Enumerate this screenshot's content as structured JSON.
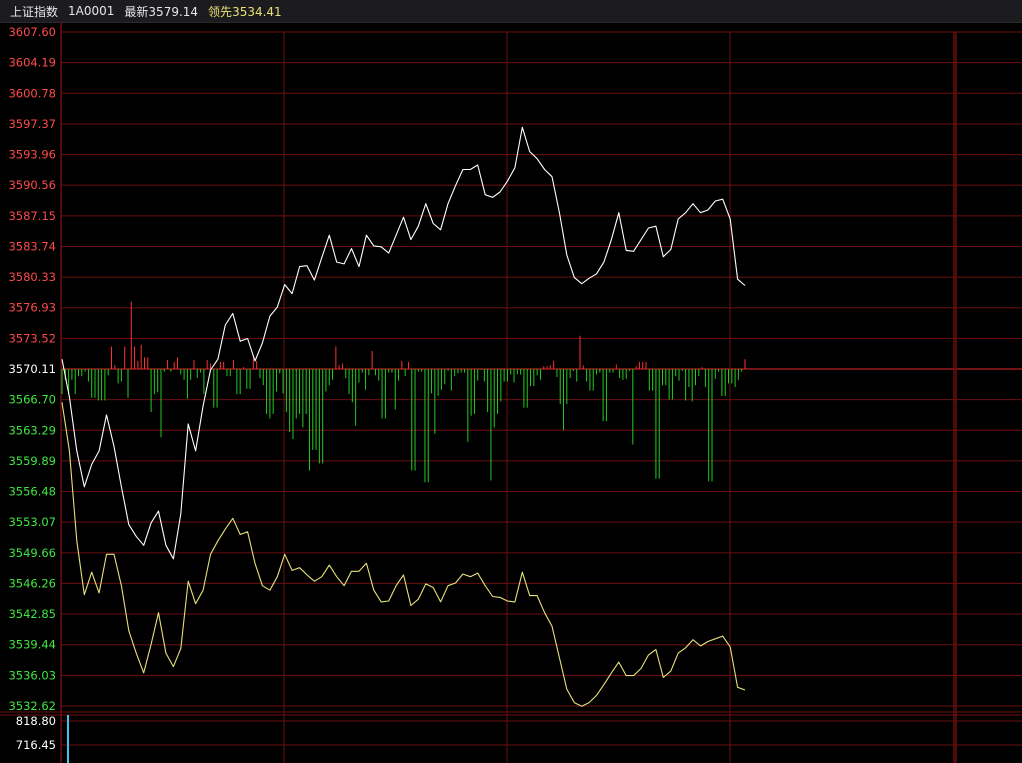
{
  "header": {
    "index_name": "上证指数",
    "code": "1A0001",
    "latest_label": "最新",
    "latest_value": "3579.14",
    "lead_label": "领先",
    "lead_value": "3534.41"
  },
  "colors": {
    "grid": "#6e0f0f",
    "up_label": "#ff4a4a",
    "down_label": "#3ee83e",
    "base_label": "#ffffff",
    "price_line": "#ffffff",
    "lead_line": "#e8e07a",
    "bar_up": "#ff3030",
    "bar_down": "#22cc22",
    "vol_bar": "#3fc8e6"
  },
  "chart_data": {
    "type": "line",
    "base_price": 3570.11,
    "price_ticks": [
      "3607.60",
      "3604.19",
      "3600.78",
      "3597.37",
      "3593.96",
      "3590.56",
      "3587.15",
      "3583.74",
      "3580.33",
      "3576.93",
      "3573.52",
      "3570.11",
      "3566.70",
      "3563.29",
      "3559.89",
      "3556.48",
      "3553.07",
      "3549.66",
      "3546.26",
      "3542.85",
      "3539.44",
      "3536.03",
      "3532.62"
    ],
    "ylim": [
      3532.62,
      3607.6
    ],
    "series": [
      {
        "role": "price",
        "values": [
          3571.2,
          3567.0,
          3561.0,
          3557.0,
          3559.5,
          3561.0,
          3565.0,
          3561.5,
          3557.0,
          3552.8,
          3551.5,
          3550.5,
          3553.0,
          3554.3,
          3550.5,
          3549.0,
          3554.0,
          3564.0,
          3561.0,
          3566.0,
          3570.0,
          3571.2,
          3575.0,
          3576.3,
          3573.2,
          3573.5,
          3571.0,
          3573.0,
          3576.0,
          3577.0,
          3579.5,
          3578.5,
          3581.5,
          3581.6,
          3580.0,
          3582.5,
          3585.0,
          3582.0,
          3581.8,
          3583.5,
          3581.5,
          3585.0,
          3583.8,
          3583.7,
          3583.0,
          3585.0,
          3587.0,
          3584.5,
          3586.0,
          3588.5,
          3586.3,
          3585.6,
          3588.5,
          3590.5,
          3592.3,
          3592.3,
          3592.8,
          3589.5,
          3589.2,
          3589.8,
          3591.0,
          3592.5,
          3597.0,
          3594.3,
          3593.5,
          3592.3,
          3591.5,
          3587.5,
          3582.8,
          3580.3,
          3579.6,
          3580.2,
          3580.7,
          3582.0,
          3584.5,
          3587.5,
          3583.3,
          3583.2,
          3584.5,
          3585.8,
          3586.0,
          3582.6,
          3583.4,
          3586.8,
          3587.5,
          3588.5,
          3587.5,
          3587.8,
          3588.8,
          3589.0,
          3586.8,
          3580.1,
          3579.4
        ]
      },
      {
        "role": "lead",
        "values": [
          3566.4,
          3561.0,
          3551.0,
          3545.0,
          3547.5,
          3545.2,
          3549.5,
          3549.5,
          3546.0,
          3541.0,
          3538.5,
          3536.3,
          3539.5,
          3543.0,
          3538.5,
          3537.0,
          3539.0,
          3546.5,
          3544.0,
          3545.5,
          3549.5,
          3551.0,
          3552.3,
          3553.5,
          3551.7,
          3552.0,
          3548.5,
          3546.0,
          3545.5,
          3547.0,
          3549.5,
          3547.7,
          3548.0,
          3547.2,
          3546.5,
          3547.0,
          3548.3,
          3547.0,
          3546.0,
          3547.6,
          3547.6,
          3548.5,
          3545.5,
          3544.2,
          3544.3,
          3546.0,
          3547.2,
          3543.8,
          3544.5,
          3546.2,
          3545.8,
          3544.2,
          3546.0,
          3546.3,
          3547.3,
          3547.0,
          3547.4,
          3546.0,
          3544.8,
          3544.7,
          3544.3,
          3544.2,
          3547.5,
          3544.9,
          3544.9,
          3543.0,
          3541.5,
          3538.0,
          3534.5,
          3533.0,
          3532.6,
          3533.0,
          3533.8,
          3535.0,
          3536.3,
          3537.5,
          3536.0,
          3536.0,
          3536.8,
          3538.3,
          3538.9,
          3535.8,
          3536.5,
          3538.5,
          3539.1,
          3540.0,
          3539.3,
          3539.8,
          3540.1,
          3540.4,
          3539.2,
          3534.7,
          3534.4
        ]
      }
    ],
    "bars": [
      -2.8,
      -1.2,
      -2.8,
      -1.2,
      -2.8,
      -0.8,
      -0.8,
      -0.3,
      -1.4,
      -3.2,
      -3.2,
      -3.5,
      -3.5,
      -3.5,
      -0.7,
      2.5,
      0.4,
      -1.6,
      -1.4,
      2.5,
      -3.2,
      7.5,
      2.5,
      0.9,
      2.7,
      1.3,
      1.3,
      -4.8,
      -2.8,
      -2.6,
      -7.6,
      -0.3,
      1.0,
      -0.3,
      0.8,
      1.3,
      -0.6,
      -1.2,
      -3.3,
      -1.2,
      1.0,
      -1.0,
      -0.4,
      -2.8,
      1.0,
      0.6,
      -4.3,
      -4.3,
      0.8,
      0.8,
      -0.8,
      -0.8,
      1.0,
      -2.8,
      -2.8,
      0.2,
      -2.2,
      -2.2,
      1.5,
      0.9,
      -1.0,
      -1.8,
      -5.0,
      -5.5,
      -5.0,
      -2.5,
      -0.5,
      -2.7,
      -4.8,
      -7.0,
      -7.8,
      -5.5,
      -5.0,
      -6.5,
      -5.0,
      -11.3,
      -9.0,
      -9.0,
      -10.5,
      -10.5,
      -2.5,
      -1.8,
      -1.2,
      2.5,
      0.4,
      0.6,
      -1.0,
      -2.8,
      -3.7,
      -6.3,
      -1.5,
      -0.4,
      -2.3,
      -0.7,
      2.0,
      -0.7,
      -1.3,
      -5.5,
      -5.5,
      -0.4,
      -0.4,
      -4.5,
      -1.3,
      0.9,
      -0.8,
      0.8,
      -11.3,
      -11.3,
      -0.3,
      -0.3,
      -12.6,
      -12.6,
      -2.7,
      -7.2,
      -3.0,
      -2.3,
      -1.7,
      -0.2,
      -2.4,
      -0.8,
      -0.5,
      -0.4,
      -0.4,
      -8.1,
      -5.2,
      -5.0,
      -1.3,
      -0.1,
      -1.4,
      -4.8,
      -12.4,
      -6.5,
      -5.0,
      -3.6,
      -1.4,
      -1.4,
      -0.6,
      -1.5,
      -0.6,
      -0.6,
      -4.3,
      -4.3,
      -1.9,
      -1.9,
      -0.7,
      -1.2,
      0.3,
      0.3,
      0.4,
      0.9,
      -0.9,
      -3.9,
      -6.8,
      -3.9,
      -1.0,
      -0.2,
      -1.4,
      3.7,
      0.4,
      -1.4,
      -2.4,
      -2.4,
      -0.6,
      -0.4,
      -5.8,
      -5.8,
      -0.4,
      -0.4,
      0.5,
      -1.0,
      -1.2,
      -1.1,
      -0.2,
      -8.4,
      0.3,
      0.8,
      0.8,
      0.8,
      -2.4,
      -2.4,
      -12.2,
      -12.2,
      -1.8,
      -1.8,
      -3.4,
      -3.4,
      -0.8,
      -1.3,
      -0.2,
      -3.5,
      -2.0,
      -3.6,
      -1.8,
      -0.8,
      0.2,
      -2.0,
      -12.5,
      -12.5,
      -1.1,
      -0.3,
      -3.0,
      -3.0,
      -1.6,
      -1.6,
      -2.0,
      -1.2,
      -0.3,
      1.1
    ],
    "volume_ticks": [
      "818.80",
      "716.45"
    ],
    "volume_bar": 818.8
  }
}
